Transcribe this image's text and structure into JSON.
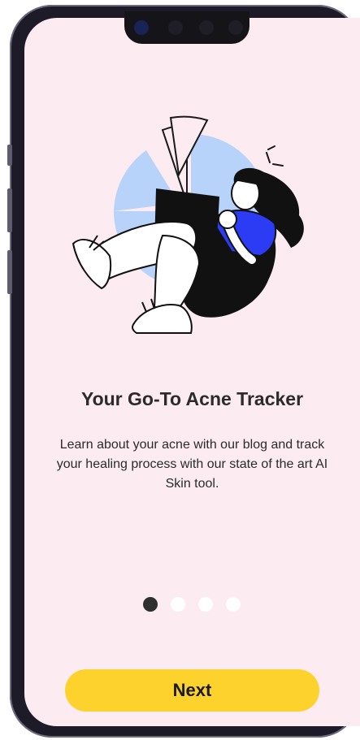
{
  "onboarding": {
    "title": "Your Go-To Acne Tracker",
    "description": "Learn about your acne with our blog and track your healing process with our state of the art AI Skin tool.",
    "current_page": 1,
    "page_count": 4,
    "next_label": "Next"
  },
  "colors": {
    "background": "#fcebf0",
    "button": "#fdd22c",
    "accent_blue": "#2b3cf4",
    "chart_blue": "#b8d3fa",
    "dot_active": "#2f2f2f",
    "dot_inactive": "#ffffff"
  },
  "icons": {
    "illustration": "woman-with-laptop-pie-chart-illustration"
  }
}
